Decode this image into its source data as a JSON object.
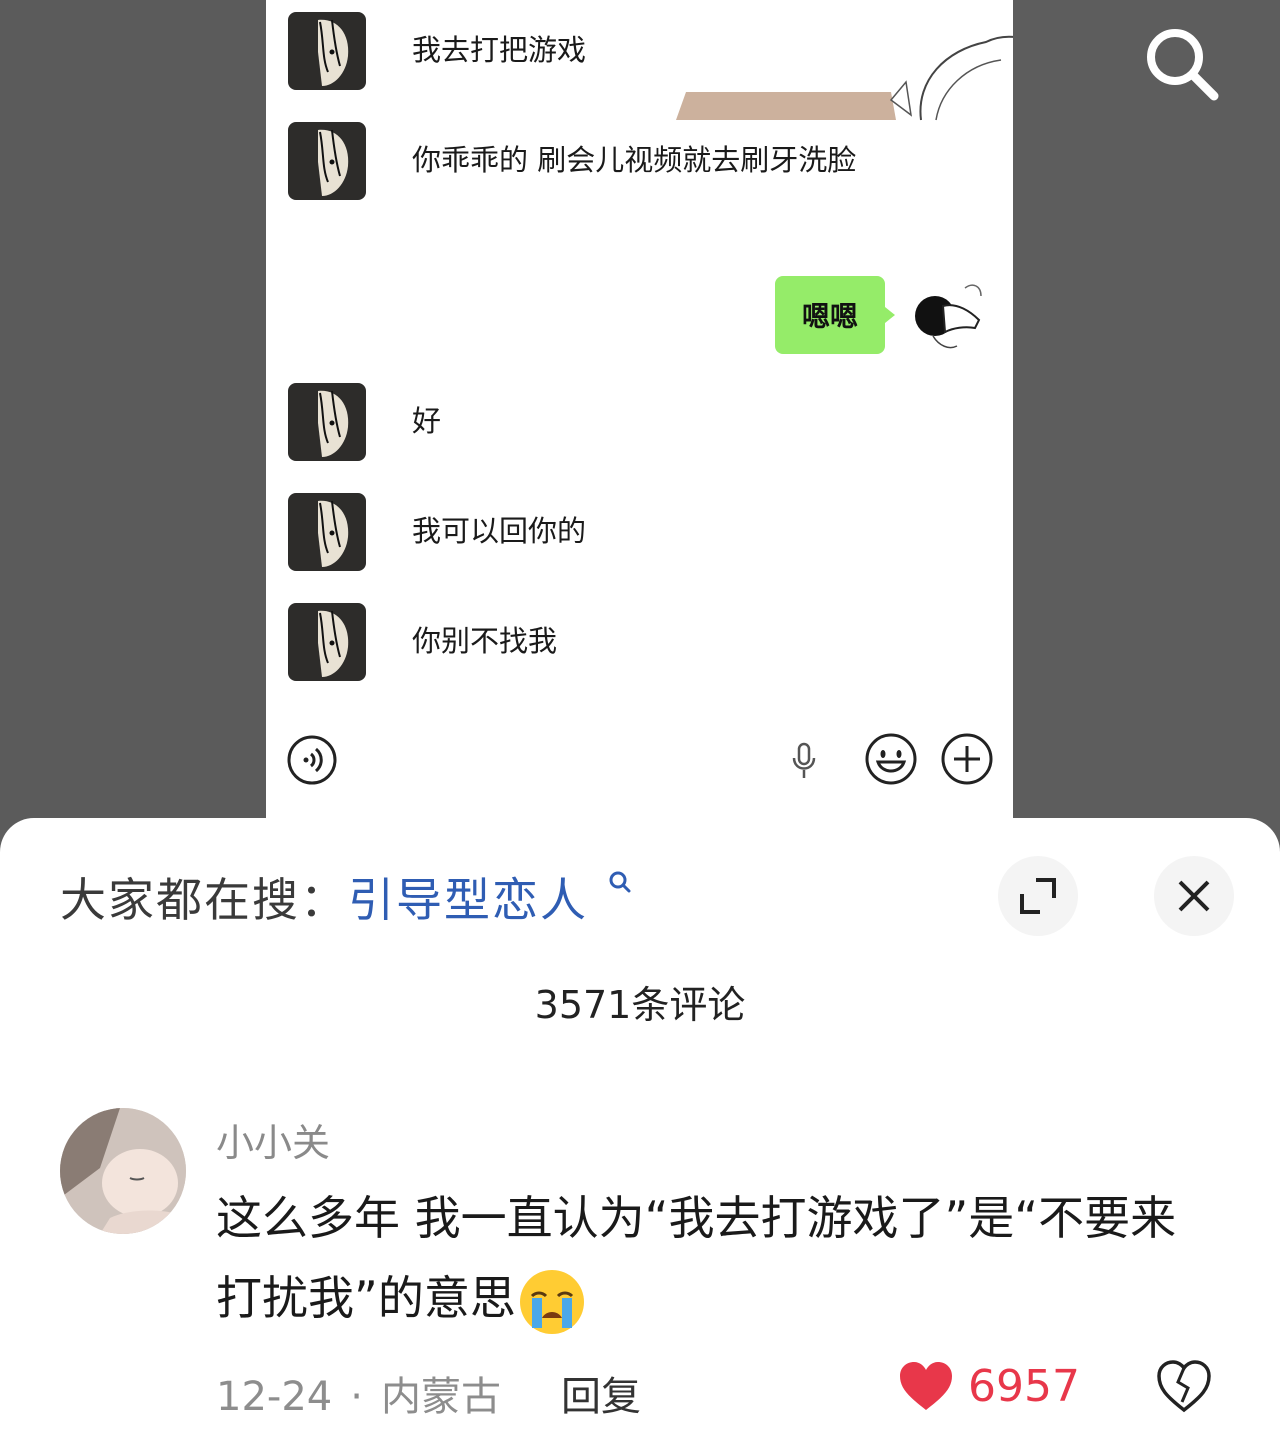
{
  "chat": {
    "messages_left": [
      {
        "text": "我去打把游戏"
      },
      {
        "text": "你乖乖的 刷会儿视频就去刷牙洗脸"
      },
      {
        "text": "好"
      },
      {
        "text": "我可以回你的"
      },
      {
        "text": "你别不找我"
      }
    ],
    "message_right": {
      "text": "嗯嗯"
    }
  },
  "sheet": {
    "search_prefix": "大家都在搜：",
    "search_keyword": "引导型恋人",
    "comment_count": "3571条评论"
  },
  "comment": {
    "username": "小小关",
    "text": "这么多年 我一直认为“我去打游戏了”是“不要来打扰我”的意思",
    "date": "12-24",
    "separator": "·",
    "location": "内蒙古",
    "reply_label": "回复",
    "likes": "6957"
  },
  "colors": {
    "accent_green": "#95ec69",
    "keyword_blue": "#2f5db3",
    "like_red": "#e8374a"
  },
  "icons": [
    "search-icon",
    "voice-icon",
    "mic-icon",
    "emoji-icon",
    "plus-icon",
    "expand-icon",
    "close-icon",
    "heart-icon",
    "broken-heart-icon",
    "crying-emoji-icon"
  ]
}
